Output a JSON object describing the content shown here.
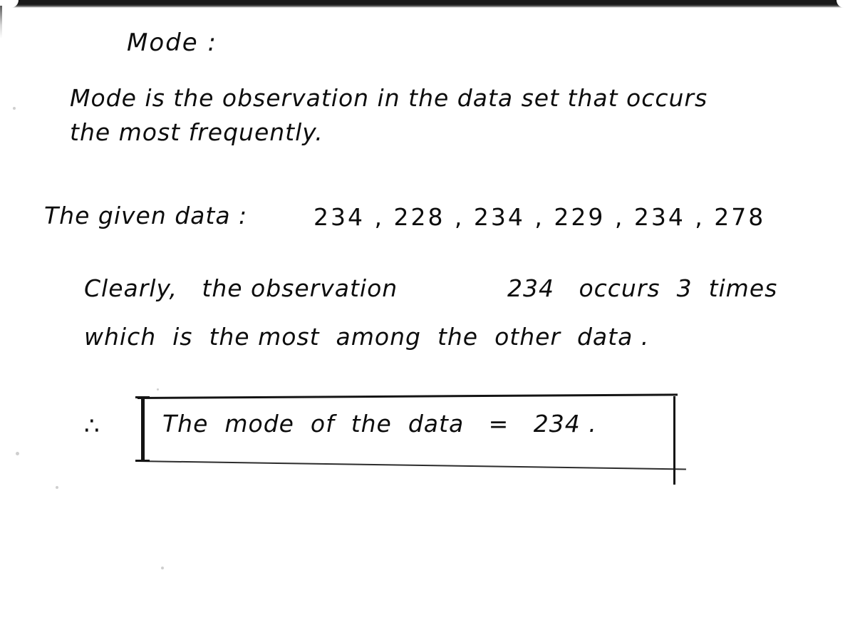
{
  "document": {
    "type": "handwritten-note",
    "title": "Mode :",
    "definition_line_1": "Mode is the observation in the data set that occurs",
    "definition_line_2": "the most frequently.",
    "given_data_label": "The given data :",
    "given_data_values": "234 , 228 , 234 , 229 , 234 , 278",
    "reasoning_line_1_left": "Clearly,   the observation",
    "reasoning_line_1_right": "234   occurs  3  times",
    "reasoning_line_2": "which  is  the most  among  the  other  data .",
    "therefore_symbol": "∴",
    "boxed_conclusion": "The  mode  of  the  data   =   234 ."
  },
  "data_set": {
    "values": [
      234,
      228,
      234,
      229,
      234,
      278
    ],
    "mode": 234,
    "mode_frequency": 3
  },
  "colors": {
    "ink": "#0d0d0d",
    "paper": "#ffffff",
    "scan_edge": "#141414"
  }
}
